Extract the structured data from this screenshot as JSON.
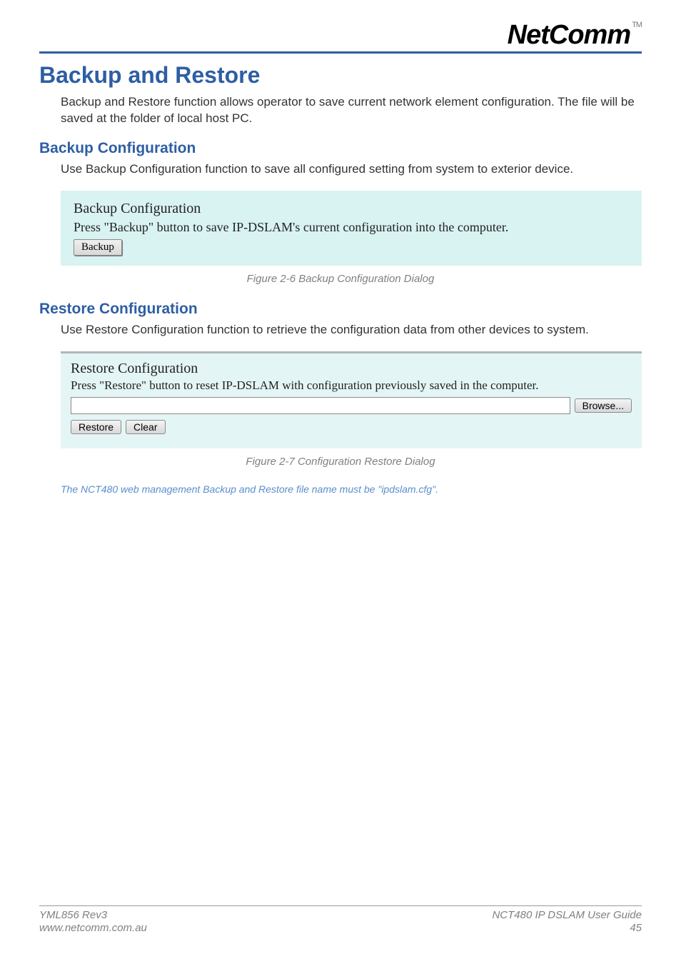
{
  "logo": {
    "text": "NetComm",
    "tm": "TM"
  },
  "heading": "Backup and Restore",
  "intro": "Backup and Restore function allows operator to save current network element configuration. The file will be saved at the folder of local host PC.",
  "backup": {
    "heading": "Backup Configuration",
    "desc": "Use Backup Configuration function to save all configured setting from system to exterior device.",
    "panel_title": "Backup Configuration",
    "panel_text": "Press \"Backup\" button to save IP-DSLAM's current configuration into the computer.",
    "button": "Backup",
    "caption": "Figure 2-6 Backup Configuration Dialog"
  },
  "restore": {
    "heading": "Restore Configuration",
    "desc": "Use Restore Configuration function to retrieve the configuration data from other devices to system.",
    "panel_title": "Restore Configuration",
    "panel_text": "Press \"Restore\" button to reset IP-DSLAM with configuration previously saved in the computer.",
    "browse": "Browse...",
    "restore_btn": "Restore",
    "clear_btn": "Clear",
    "caption": "Figure 2-7 Configuration Restore Dialog"
  },
  "note": "The NCT480 web management Backup and Restore file name must be \"ipdslam.cfg\".",
  "footer": {
    "rev": "YML856 Rev3",
    "url": "www.netcomm.com.au",
    "guide": "NCT480 IP DSLAM User Guide",
    "page": "45"
  }
}
